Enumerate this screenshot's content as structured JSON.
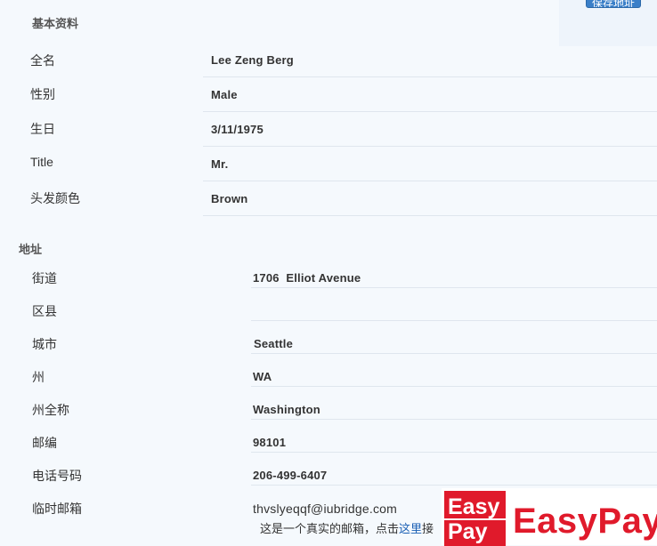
{
  "toolbar": {
    "save_label": "保存地址"
  },
  "basic": {
    "title": "基本资料",
    "fields": [
      {
        "label": "全名",
        "value": "Lee Zeng Berg"
      },
      {
        "label": "性别",
        "value": "Male"
      },
      {
        "label": "生日",
        "value": "3/11/1975"
      },
      {
        "label": "Title",
        "value": "Mr."
      },
      {
        "label": "头发颜色",
        "value": "Brown"
      }
    ]
  },
  "address": {
    "title": "地址",
    "fields": [
      {
        "label": "街道",
        "value": "1706  Elliot Avenue"
      },
      {
        "label": "区县",
        "value": ""
      },
      {
        "label": "城市",
        "value": "Seattle"
      },
      {
        "label": "州",
        "value": "WA"
      },
      {
        "label": "州全称",
        "value": "Washington"
      },
      {
        "label": "邮编",
        "value": "98101"
      },
      {
        "label": "电话号码",
        "value": "206-499-6407"
      },
      {
        "label": "临时邮箱",
        "value": "thvslyeqqf@iubridge.com"
      }
    ],
    "email_note": "这是一个真实的邮箱，点击",
    "email_link": "这里",
    "email_note_tail": "接"
  },
  "ad": {
    "logo_line1": "Easy",
    "logo_line2": "Pay",
    "text": "EasyPay",
    "color": "#e01a2b"
  }
}
